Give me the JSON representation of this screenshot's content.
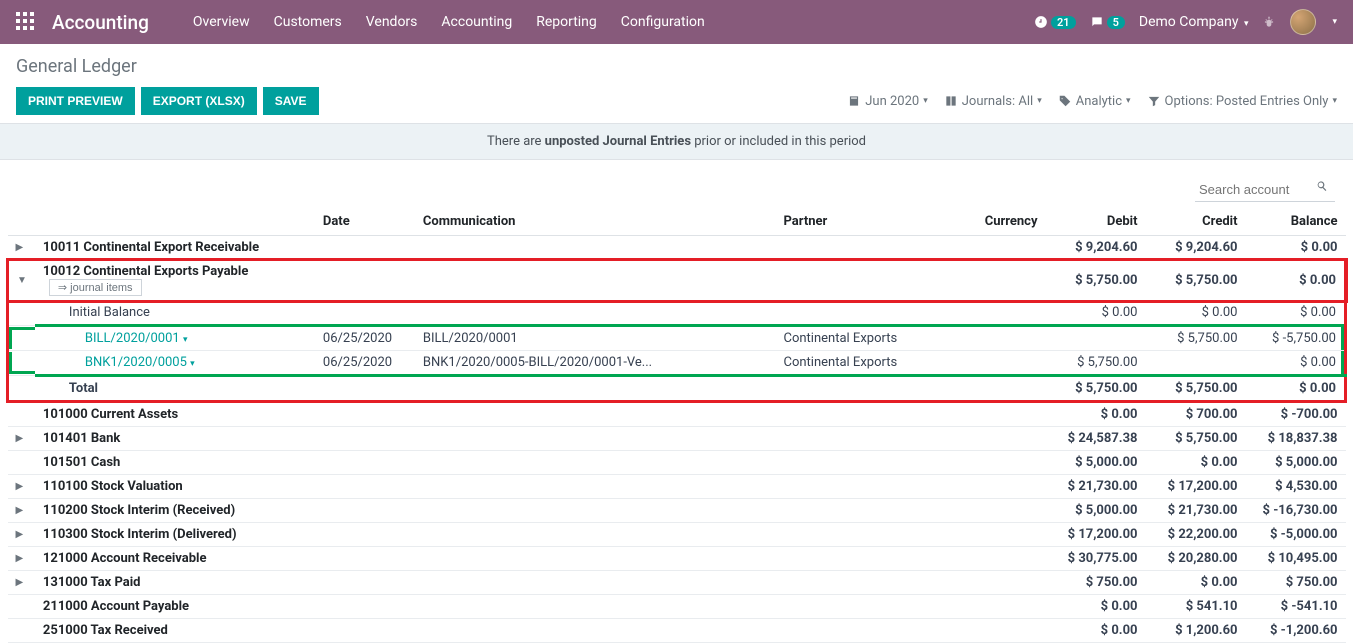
{
  "top": {
    "app": "Accounting",
    "nav": [
      "Overview",
      "Customers",
      "Vendors",
      "Accounting",
      "Reporting",
      "Configuration"
    ],
    "activity_count": "21",
    "msg_count": "5",
    "company": "Demo Company"
  },
  "page": {
    "title": "General Ledger",
    "btn_preview": "PRINT PREVIEW",
    "btn_export": "EXPORT (XLSX)",
    "btn_save": "SAVE"
  },
  "filters": {
    "date": "Jun 2020",
    "journals": "Journals: All",
    "analytic": "Analytic",
    "options": "Options: Posted Entries Only"
  },
  "banner": {
    "pre": "There are ",
    "bold": "unposted Journal Entries",
    "post": " prior or included in this period"
  },
  "search_placeholder": "Search account",
  "cols": {
    "date": "Date",
    "comm": "Communication",
    "partner": "Partner",
    "currency": "Currency",
    "debit": "Debit",
    "credit": "Credit",
    "balance": "Balance"
  },
  "ji_btn": "⇒ journal items",
  "rows": {
    "r0": {
      "caret": "▶",
      "name": "10011 Continental Export Receivable",
      "debit": "$ 9,204.60",
      "credit": "$ 9,204.60",
      "balance": "$ 0.00"
    },
    "r1": {
      "caret": "▼",
      "name": "10012 Continental Exports Payable",
      "debit": "$ 5,750.00",
      "credit": "$ 5,750.00",
      "balance": "$ 0.00"
    },
    "initbal": {
      "label": "Initial Balance",
      "debit": "$ 0.00",
      "credit": "$ 0.00",
      "balance": "$ 0.00"
    },
    "bill": {
      "ref": "BILL/2020/0001",
      "date": "06/25/2020",
      "comm": "BILL/2020/0001",
      "partner": "Continental Exports",
      "debit": "",
      "credit": "$ 5,750.00",
      "balance": "$ -5,750.00"
    },
    "bnk": {
      "ref": "BNK1/2020/0005",
      "date": "06/25/2020",
      "comm": "BNK1/2020/0005-BILL/2020/0001-Ve...",
      "partner": "Continental Exports",
      "debit": "$ 5,750.00",
      "credit": "",
      "balance": "$ 0.00"
    },
    "total": {
      "label": "Total",
      "debit": "$ 5,750.00",
      "credit": "$ 5,750.00",
      "balance": "$ 0.00"
    },
    "r2": {
      "name": "101000 Current Assets",
      "debit": "$ 0.00",
      "credit": "$ 700.00",
      "balance": "$ -700.00"
    },
    "r3": {
      "caret": "▶",
      "name": "101401 Bank",
      "debit": "$ 24,587.38",
      "credit": "$ 5,750.00",
      "balance": "$ 18,837.38"
    },
    "r4": {
      "name": "101501 Cash",
      "debit": "$ 5,000.00",
      "credit": "$ 0.00",
      "balance": "$ 5,000.00"
    },
    "r5": {
      "caret": "▶",
      "name": "110100 Stock Valuation",
      "debit": "$ 21,730.00",
      "credit": "$ 17,200.00",
      "balance": "$ 4,530.00"
    },
    "r6": {
      "caret": "▶",
      "name": "110200 Stock Interim (Received)",
      "debit": "$ 5,000.00",
      "credit": "$ 21,730.00",
      "balance": "$ -16,730.00"
    },
    "r7": {
      "caret": "▶",
      "name": "110300 Stock Interim (Delivered)",
      "debit": "$ 17,200.00",
      "credit": "$ 22,200.00",
      "balance": "$ -5,000.00"
    },
    "r8": {
      "caret": "▶",
      "name": "121000 Account Receivable",
      "debit": "$ 30,775.00",
      "credit": "$ 20,280.00",
      "balance": "$ 10,495.00"
    },
    "r9": {
      "caret": "▶",
      "name": "131000 Tax Paid",
      "debit": "$ 750.00",
      "credit": "$ 0.00",
      "balance": "$ 750.00"
    },
    "r10": {
      "name": "211000 Account Payable",
      "debit": "$ 0.00",
      "credit": "$ 541.10",
      "balance": "$ -541.10"
    },
    "r11": {
      "name": "251000 Tax Received",
      "debit": "$ 0.00",
      "credit": "$ 1,200.60",
      "balance": "$ -1,200.60"
    }
  }
}
